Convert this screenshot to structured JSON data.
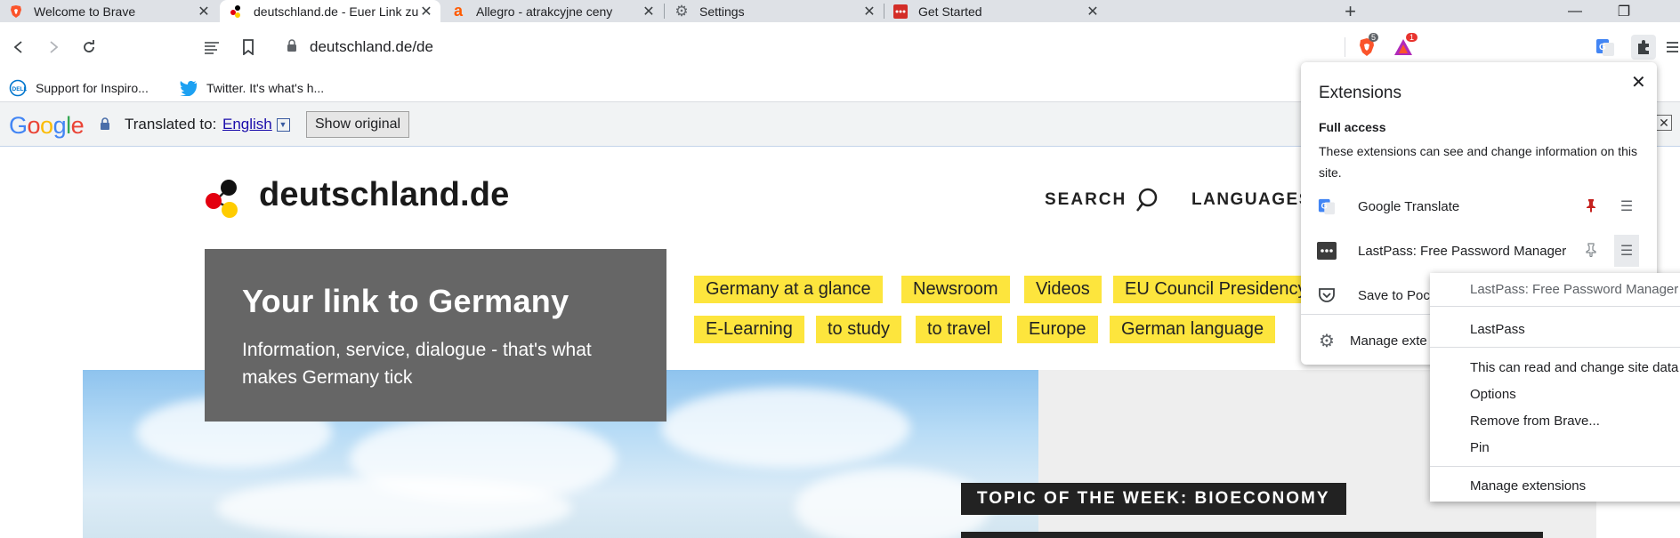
{
  "tabs": [
    {
      "title": "Welcome to Brave",
      "icon": "brave-icon",
      "active": false
    },
    {
      "title": "deutschland.de - Euer Link zu Deut",
      "icon": "deutschland-favicon",
      "active": true
    },
    {
      "title": "Allegro - atrakcyjne ceny",
      "icon": "allegro-icon",
      "active": false
    },
    {
      "title": "Settings",
      "icon": "gear-icon",
      "active": false
    },
    {
      "title": "Get Started",
      "icon": "lastpass-icon",
      "active": false
    }
  ],
  "toolbar": {
    "url": "deutschland.de/de",
    "brave_shields_badge": "5",
    "brave_rewards_badge": "1"
  },
  "bookmarks": [
    {
      "label": "Support for Inspiro...",
      "icon": "dell-icon"
    },
    {
      "label": "Twitter. It's what's h...",
      "icon": "twitter-icon"
    }
  ],
  "translate_bar": {
    "logo": "Google",
    "translated_to_label": "Translated to:",
    "language": "English",
    "show_original": "Show original"
  },
  "site": {
    "name": "deutschland.de",
    "nav_search": "SEARCH",
    "nav_languages": "LANGUAGES",
    "hero_title": "Your link to Germany",
    "hero_subtitle": "Information, service, dialogue - that's what makes Germany tick",
    "chips": [
      "Germany at a glance",
      "Newsroom",
      "Videos",
      "EU Council Presidency",
      "E-Learning",
      "to study",
      "to travel",
      "Europe",
      "German language"
    ],
    "topic_banner": "TOPIC OF THE WEEK: BIOECONOMY"
  },
  "extensions_popup": {
    "title": "Extensions",
    "section_title": "Full access",
    "section_desc": "These extensions can see and change information on this site.",
    "items": [
      {
        "name": "Google Translate",
        "icon": "google-translate-icon",
        "pinned": true
      },
      {
        "name": "LastPass: Free Password Manager",
        "icon": "lastpass-icon",
        "pinned": false
      },
      {
        "name": "Save to Pock",
        "icon": "pocket-icon",
        "pinned": false
      }
    ],
    "manage_label": "Manage exte"
  },
  "context_menu": {
    "header": "LastPass: Free Password Manager",
    "items": [
      "LastPass",
      "This can read and change site data",
      "Options",
      "Remove from Brave...",
      "Pin",
      "Manage extensions"
    ]
  },
  "colors": {
    "chip_yellow": "#fde53d",
    "hero_gray": "#666666",
    "brave_orange": "#fb542b",
    "lastpass_red": "#d32d27"
  }
}
